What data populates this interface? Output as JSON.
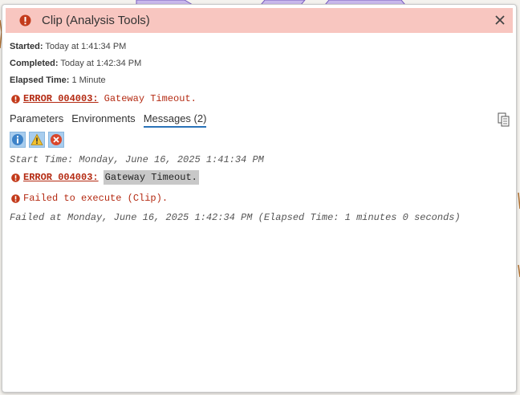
{
  "window": {
    "title": "Clip (Analysis Tools)",
    "status_icon": "error-icon",
    "close_icon": "close-icon"
  },
  "summary": {
    "started_label": "Started:",
    "started_value": "Today at 1:41:34 PM",
    "completed_label": "Completed:",
    "completed_value": "Today at 1:42:34 PM",
    "elapsed_label": "Elapsed Time:",
    "elapsed_value": "1 Minute",
    "error_code": "ERROR 004003:",
    "error_text": "Gateway Timeout."
  },
  "tabs": [
    {
      "label": "Parameters",
      "active": false
    },
    {
      "label": "Environments",
      "active": false
    },
    {
      "label": "Messages (2)",
      "active": true
    }
  ],
  "filters": {
    "info_icon": "info-icon",
    "warning_icon": "warning-icon",
    "error_icon": "error-filter-icon"
  },
  "messages": {
    "start": "Start Time: Monday, June 16, 2025 1:41:34 PM",
    "error_code": "ERROR 004003:",
    "error_text": "Gateway Timeout.",
    "failed_execute": "Failed to execute (Clip).",
    "failed_at": "Failed at Monday, June 16, 2025 1:42:34 PM (Elapsed Time: 1 minutes 0 seconds)"
  },
  "colors": {
    "header_bg": "#f8c6c0",
    "error_red": "#b42a12",
    "tab_accent": "#2a73b8",
    "filter_bg": "#a8cdee"
  }
}
